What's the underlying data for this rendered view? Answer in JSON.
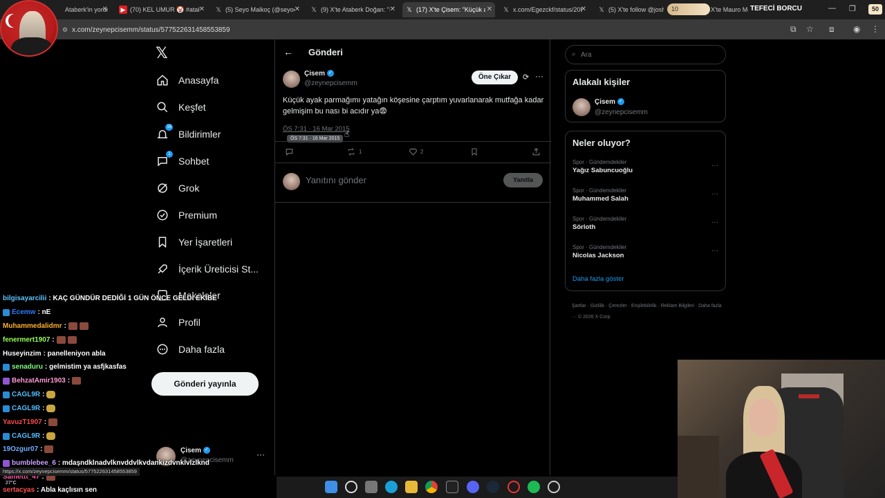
{
  "browser": {
    "tabs": [
      {
        "title": "Ataberk'in yorumu sı"
      },
      {
        "title": "(70) KEL UMUR 🤡 #atab"
      },
      {
        "title": "(5) Seyo Malkoç (@seyoo"
      },
      {
        "title": "(9) X'te Ataberk Doğan: \"I"
      },
      {
        "title": "(17) X'te Çisem: \"Küçük a"
      },
      {
        "title": "x.com/Egezckf/status/208"
      },
      {
        "title": "(5) X'te follow @joshuaxl"
      },
      {
        "title": "X'te Mauro Men"
      }
    ],
    "url": "x.com/zeynepcisemm/status/577522631458553859",
    "status_url": "https://x.com/zeynepcisemm/status/577522631458553859"
  },
  "overlay": {
    "level": "10",
    "label": "TEFECİ BORCU",
    "count": "50"
  },
  "nav": {
    "items": [
      {
        "label": "Anasayfa",
        "icon": "home-icon"
      },
      {
        "label": "Keşfet",
        "icon": "search-icon"
      },
      {
        "label": "Bildirimler",
        "icon": "bell-icon",
        "badge": "16"
      },
      {
        "label": "Sohbet",
        "icon": "chat-icon",
        "badge": "1"
      },
      {
        "label": "Grok",
        "icon": "grok-icon"
      },
      {
        "label": "Premium",
        "icon": "premium-icon"
      },
      {
        "label": "Yer İşaretleri",
        "icon": "bookmark-icon"
      },
      {
        "label": "İçerik Üreticisi St...",
        "icon": "rocket-icon"
      },
      {
        "label": "Makaleler",
        "icon": "article-icon"
      },
      {
        "label": "Profil",
        "icon": "person-icon"
      },
      {
        "label": "Daha fazla",
        "icon": "more-circle-icon"
      }
    ],
    "post_button": "Gönderi yayınla",
    "account_name": "Çisem",
    "account_handle": "@zeynepcisemm"
  },
  "post": {
    "header_title": "Gönderi",
    "author": "Çisem",
    "handle": "@zeynepcisemm",
    "promote_label": "Öne Çıkar",
    "text": "Küçük ayak parmağımı yatağın köşesine çarptım yuvarlanarak mutfağa kadar gelmişim bu nası bi acıdır ya😨",
    "timestamp": "ÖS 7:31 · 16 Mar 2015",
    "tooltip": "ÖS 7:31 · 16 Mar 2015",
    "retweets": "1",
    "likes": "2",
    "reply_placeholder": "Yanıtını gönder",
    "reply_button": "Yanıtla"
  },
  "sidebar": {
    "search_placeholder": "Ara",
    "related_title": "Alakalı kişiler",
    "related_name": "Çisem",
    "related_handle": "@zeynepcisemm",
    "trends_title": "Neler oluyor?",
    "trends": [
      {
        "category": "Spor · Gündemdekiler",
        "name": "Yağız Sabuncuoğlu"
      },
      {
        "category": "Spor · Gündemdekiler",
        "name": "Muhammed Salah"
      },
      {
        "category": "Spor · Gündemdekiler",
        "name": "Sörloth"
      },
      {
        "category": "Spor · Gündemdekiler",
        "name": "Nicolas Jackson"
      }
    ],
    "show_more": "Daha fazla göster",
    "footer": "Şartlar · Gizlilik · Çerezler · Erişilebilirlik · Reklam Bilgileri · Daha fazla ··· © 2026 X Corp."
  },
  "chat": [
    {
      "user": "bilgisayarcilii",
      "msg": ": KAÇ GÜNDÜR DEDİĞİ 1 GÜN ÖNCE GELDİ EKİBE",
      "color": "#5fc3ff"
    },
    {
      "user": "Ecemw",
      "msg": ": nE",
      "color": "#2f7cff"
    },
    {
      "user": "Muhammedalidmr",
      "msg": ":",
      "color": "#ffb030"
    },
    {
      "user": "fenermert1907",
      "msg": ":",
      "color": "#9aff5a"
    },
    {
      "user": "Huseyinzim",
      "msg": ": panelleniyon abla",
      "color": "#ffffff"
    },
    {
      "user": "senaduru",
      "msg": ": gelmistim ya asfjkasfas",
      "color": "#7dff7d"
    },
    {
      "user": "BehzatAmir1903",
      "msg": ":",
      "color": "#ff9ad5"
    },
    {
      "user": "CAGL9R",
      "msg": ":",
      "color": "#4fc0ff"
    },
    {
      "user": "CAGL9R",
      "msg": ":",
      "color": "#4fc0ff"
    },
    {
      "user": "YavuzT1907",
      "msg": ":",
      "color": "#ff4a4a"
    },
    {
      "user": "CAGL9R",
      "msg": ":",
      "color": "#4fc0ff"
    },
    {
      "user": "19Ozgur07",
      "msg": ":",
      "color": "#6ab0ff"
    },
    {
      "user": "bumblebee_6",
      "msg": ": mdaşndklnadvlknvddvlkvdankizdvnklvlzlknd",
      "color": "#c8a0ff"
    },
    {
      "user": "Samettt_47",
      "msg": ":",
      "color": "#ff5aa8"
    },
    {
      "user": "sertacyas",
      "msg": ": Abla kaçlısın sen",
      "color": "#ff5050"
    }
  ],
  "weather": "27°C",
  "colors": {
    "accent": "#1d9bf0",
    "bg": "#000000",
    "border": "#2f3336",
    "muted": "#71767b"
  }
}
